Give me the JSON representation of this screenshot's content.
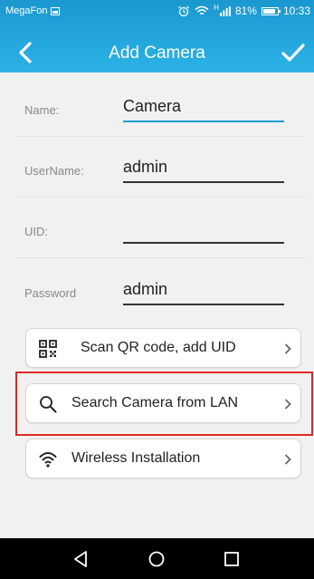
{
  "status_bar": {
    "carrier": "MegaFon",
    "signal_type": "H",
    "battery": "81%",
    "time": "10:33"
  },
  "header": {
    "title": "Add Camera",
    "back_icon": "chevron-left-icon",
    "confirm_icon": "checkmark-icon"
  },
  "form": {
    "name": {
      "label": "Name:",
      "value": "Camera"
    },
    "username": {
      "label": "UserName:",
      "value": "admin"
    },
    "uid": {
      "label": "UID:",
      "value": ""
    },
    "password": {
      "label": "Password",
      "value": "admin"
    }
  },
  "actions": [
    {
      "label": "Scan QR code, add UID",
      "icon": "qr-code-icon"
    },
    {
      "label": "Search Camera from LAN",
      "icon": "search-icon"
    },
    {
      "label": "Wireless Installation",
      "icon": "wifi-icon"
    }
  ],
  "colors": {
    "header": "#1a98cf",
    "accent_underline": "#1a9bd2",
    "highlight": "#e02828",
    "background": "#f1f1f1"
  },
  "nav_bar": {
    "back": "triangle-back-icon",
    "home": "circle-home-icon",
    "recents": "square-recents-icon"
  }
}
